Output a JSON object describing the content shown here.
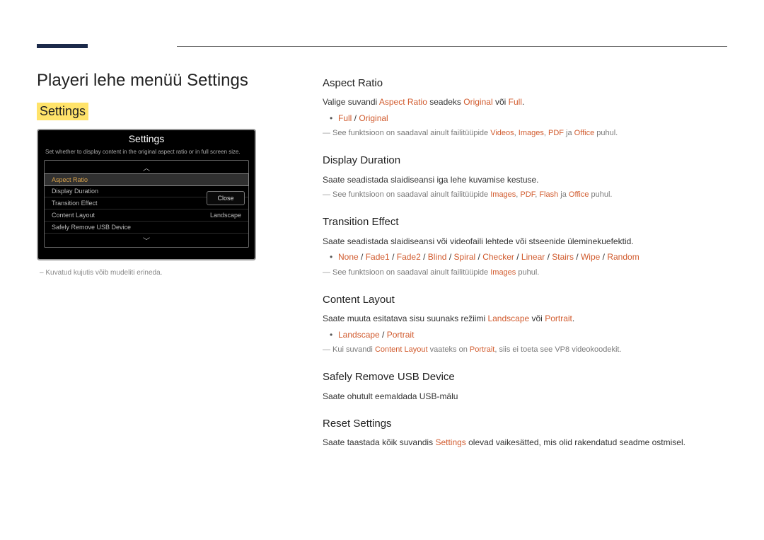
{
  "page": {
    "title_prefix": "Playeri lehe menüü ",
    "title_kw": "Settings",
    "sub": "Settings"
  },
  "panel": {
    "title": "Settings",
    "desc": "Set whether to display content in the original aspect ratio or in full screen size.",
    "rows": {
      "aspect": "Aspect Ratio",
      "duration": "Display Duration",
      "transition": "Transition Effect",
      "layout": "Content Layout",
      "layout_val": "Landscape",
      "safely": "Safely Remove USB Device"
    },
    "close": "Close"
  },
  "caption": "–  Kuvatud kujutis võib mudeliti erineda.",
  "sections": {
    "aspect": {
      "h": "Aspect Ratio",
      "l1a": "Valige suvandi ",
      "l1b": "Aspect Ratio",
      "l1c": " seadeks ",
      "l1d": "Original",
      "l1e": " või ",
      "l1f": "Full",
      "l1g": ".",
      "opt1": "Full",
      "optsep": " / ",
      "opt2": "Original",
      "n1a": "See funktsioon on saadaval ainult failitüüpide ",
      "n1b": "Videos",
      "n1c": ", ",
      "n1d": "Images",
      "n1e": ", ",
      "n1f": "PDF",
      "n1g": " ja ",
      "n1h": "Office",
      "n1i": " puhul."
    },
    "duration": {
      "h": "Display Duration",
      "l1": "Saate seadistada slaidiseansi iga lehe kuvamise kestuse.",
      "n1a": "See funktsioon on saadaval ainult failitüüpide ",
      "n1b": "Images",
      "n1c": ", ",
      "n1d": "PDF",
      "n1e": ", ",
      "n1f": "Flash",
      "n1g": " ja ",
      "n1h": "Office",
      "n1i": " puhul."
    },
    "transition": {
      "h": "Transition Effect",
      "l1": "Saate seadistada slaidiseansi või videofaili lehtede või stseenide üleminekuefektid.",
      "o1": "None",
      "o2": "Fade1",
      "o3": "Fade2",
      "o4": "Blind",
      "o5": "Spiral",
      "o6": "Checker",
      "o7": "Linear",
      "o8": "Stairs",
      "o9": "Wipe",
      "o10": "Random",
      "sep": " / ",
      "n1a": "See funktsioon on saadaval ainult failitüüpide ",
      "n1b": "Images",
      "n1c": " puhul."
    },
    "layout": {
      "h": "Content Layout",
      "l1a": "Saate muuta esitatava sisu suunaks režiimi ",
      "l1b": "Landscape",
      "l1c": " või ",
      "l1d": "Portrait",
      "l1e": ".",
      "o1": "Landscape",
      "sep": " / ",
      "o2": "Portrait",
      "n1a": "Kui suvandi ",
      "n1b": "Content Layout",
      "n1c": " vaateks on ",
      "n1d": "Portrait",
      "n1e": ", siis ei toeta see VP8 videokoodekit."
    },
    "safely": {
      "h": "Safely Remove USB Device",
      "l1": "Saate ohutult eemaldada USB-mälu"
    },
    "reset": {
      "h": "Reset Settings",
      "l1a": "Saate taastada kõik suvandis ",
      "l1b": "Settings",
      "l1c": " olevad vaikesätted, mis olid rakendatud seadme ostmisel."
    }
  }
}
